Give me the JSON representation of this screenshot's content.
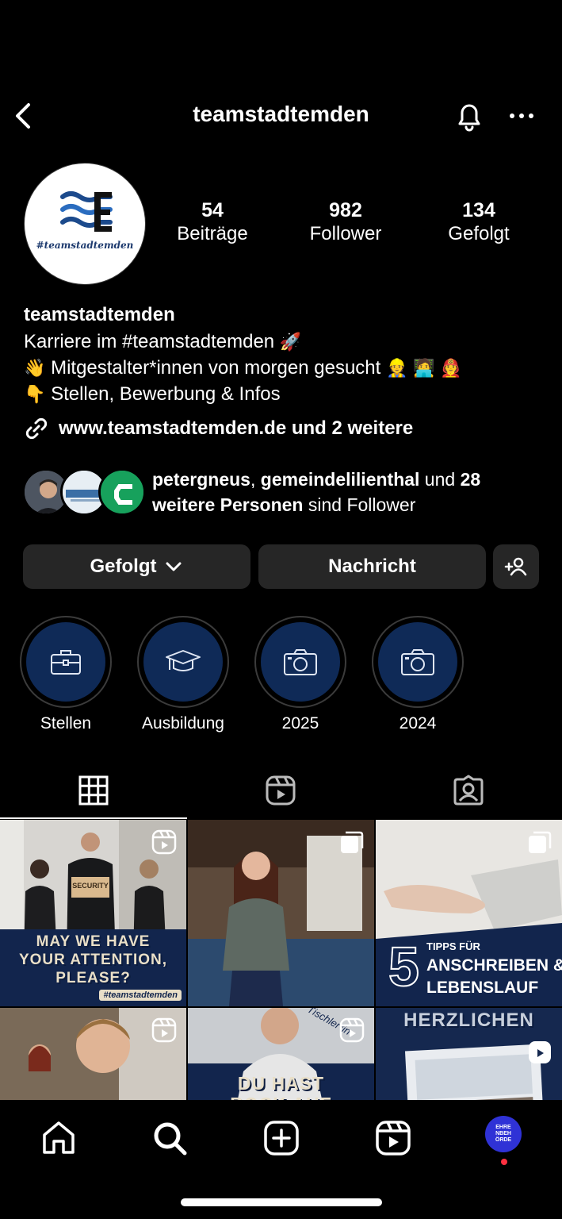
{
  "header": {
    "title": "teamstadtemden"
  },
  "profile": {
    "avatar_tag": "#teamstadtemden",
    "posts_count": "54",
    "posts_label": "Beiträge",
    "followers_count": "982",
    "followers_label": "Follower",
    "following_count": "134",
    "following_label": "Gefolgt"
  },
  "bio": {
    "name": "teamstadtemden",
    "line1": "Karriere im #teamstadtemden",
    "line2": "Mitgestalter*innen von morgen gesucht",
    "line3": "Stellen, Bewerbung & Infos",
    "link": "www.teamstadtemden.de und 2 weitere"
  },
  "mutual": {
    "user1": "petergneus",
    "sep": ", ",
    "user2": "gemeindelilienthal",
    "and": " und ",
    "others": "28 weitere Personen",
    "suffix": " sind Follower"
  },
  "actions": {
    "following_label": "Gefolgt",
    "message_label": "Nachricht"
  },
  "highlights": [
    {
      "label": "Stellen",
      "icon": "briefcase-icon"
    },
    {
      "label": "Ausbildung",
      "icon": "graduation-cap-icon"
    },
    {
      "label": "2025",
      "icon": "camera-icon"
    },
    {
      "label": "2024",
      "icon": "camera-icon"
    }
  ],
  "posts": {
    "p1_sign": "SECURITY",
    "p1_caption1": "MAY WE HAVE",
    "p1_caption2": "YOUR ATTENTION,",
    "p1_caption3": "PLEASE?",
    "p1_tag": "#teamstadtemden",
    "p3_number": "5",
    "p3_line1": "TIPPS FÜR",
    "p3_line2": "ANSCHREIBEN &",
    "p3_line3": "LEBENSLAUF",
    "p5_caption1": "DU HAST",
    "p5_caption2": "BOCK AUF",
    "p5_sticker": "Tischler*in",
    "p6_caption": "HERZLICHEN"
  },
  "nav": {
    "profile_avatar_text": "EHRE NBEH ÖRDE"
  },
  "colors": {
    "background": "#000000",
    "button": "#262626",
    "highlight_fill": "#0f2a57",
    "notification_dot": "#ff3040"
  }
}
